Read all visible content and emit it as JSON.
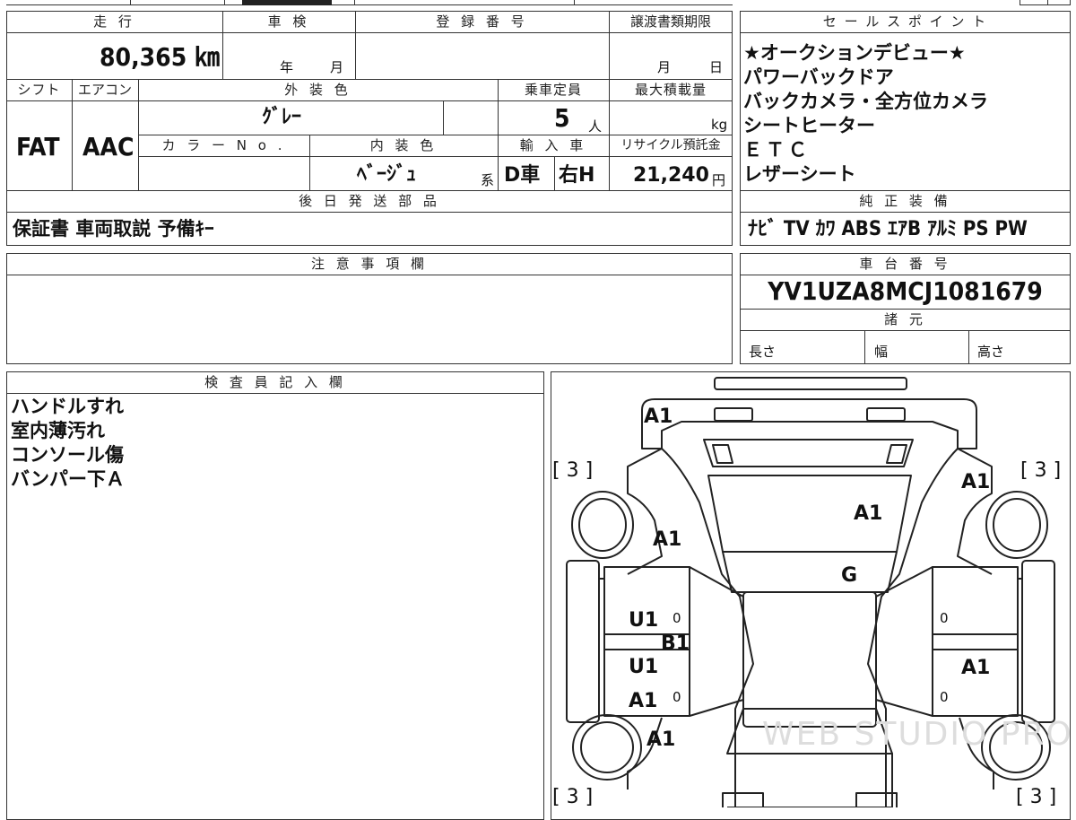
{
  "form": {
    "headers": {
      "mileage": "走 行",
      "inspection": "車 検",
      "registration": "登 録 番 号",
      "transfer_deadline": "譲渡書類期限",
      "sales_points": "セ ー ル ス ポ イ ン ト",
      "shift": "シフト",
      "aircon": "エアコン",
      "exterior_color": "外 装 色",
      "capacity": "乗車定員",
      "max_load": "最大積載量",
      "color_no": "カ ラ ー N o .",
      "interior_color": "内 装 色",
      "import": "輸 入 車",
      "recycle_fee": "リサイクル預託金",
      "later_parts": "後 日 発 送 部 品",
      "genuine_equipment": "純 正 装 備",
      "notes": "注 意 事 項 欄",
      "chassis_no": "車 台 番 号",
      "specs": "諸 元",
      "inspector": "検 査 員 記 入 欄"
    },
    "mileage": "80,365 ㎞",
    "inspection_year": "年",
    "inspection_month": "月",
    "deadline_month": "月",
    "deadline_day": "日",
    "shift": "FAT",
    "aircon": "AAC",
    "exterior_color": "ｸﾞﾚｰ",
    "capacity": "5",
    "capacity_unit": "人",
    "load_unit": "kg",
    "interior_color": "ﾍﾞｰｼﾞｭ",
    "interior_suffix": "系",
    "import_type": "D車",
    "handle": "右H",
    "recycle_fee": "21,240",
    "recycle_unit": "円",
    "later_parts": "保証書 車両取説 予備ｷｰ",
    "sales_points": [
      "★オークションデビュー★",
      "パワーバックドア",
      "バックカメラ・全方位カメラ",
      "シートヒーター",
      "ＥＴＣ",
      "レザーシート"
    ],
    "genuine_equipment": "ﾅﾋﾞ TV ｶﾜ ABS ｴｱB ｱﾙﾐ PS PW",
    "chassis_no": "YV1UZA8MCJ1081679",
    "spec_length": "長さ",
    "spec_width": "幅",
    "spec_height": "高さ",
    "inspector_notes": [
      "ハンドルすれ",
      "室内薄汚れ",
      "コンソール傷",
      "バンパー下Ａ"
    ]
  },
  "diagram": {
    "tire_labels": [
      "[ 3 ]",
      "[ 3 ]",
      "[ 3 ]",
      "[ 3 ]"
    ],
    "marks": [
      "A1",
      "A1",
      "A1",
      "A1",
      "A1",
      "G",
      "U1",
      "B1",
      "U1",
      "A1",
      "A1",
      "A1"
    ],
    "zeros": [
      "0",
      "0",
      "0",
      "0"
    ],
    "watermark": "WEB STUDIO PRO"
  }
}
